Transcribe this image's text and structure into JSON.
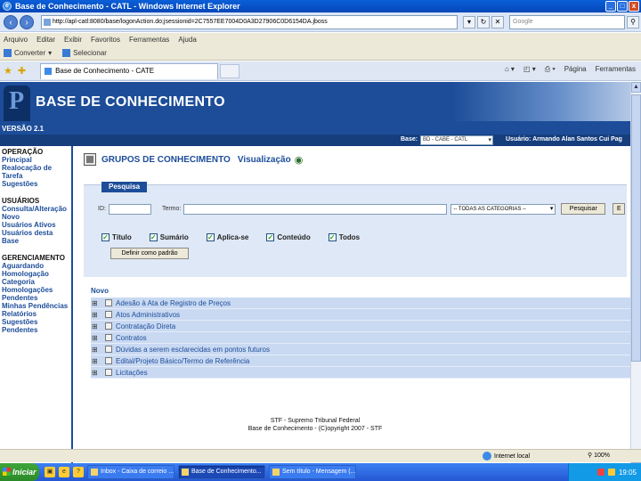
{
  "window": {
    "title": "Base de Conhecimento - CATL - Windows Internet Explorer",
    "min": "_",
    "max": "□",
    "close": "x"
  },
  "addressbar": {
    "url": "http://apl-catl:8080/base/logonAction.do;jsessionid=2C7557EE7004D0A3D27906C0D6154DA.jboss",
    "search_placeholder": "Google"
  },
  "menu": [
    "Arquivo",
    "Editar",
    "Exibir",
    "Favoritos",
    "Ferramentas",
    "Ajuda"
  ],
  "links": [
    "Converter",
    "Selecionar"
  ],
  "tab": {
    "label": "Base de Conhecimento - CATE",
    "tools": [
      "Página",
      "Ferramentas"
    ]
  },
  "header": {
    "title": "BASE DE CONHECIMENTO",
    "version": "VERSÃO 2.1",
    "base_label": "Base:",
    "base_value": "BD - CABE - CATL",
    "user": "Usuário: Armando Alan Santos Cui  Pag"
  },
  "sidebar": {
    "sections": [
      {
        "title": "OPERAÇÃO",
        "items": [
          "Principal",
          "Realocação de Tarefa",
          "Sugestões"
        ]
      },
      {
        "title": "USUÁRIOS",
        "items": [
          "Consulta/Alteração",
          "Novo",
          "Usuários Ativos",
          "Usuários desta Base"
        ]
      },
      {
        "title": "GERENCIAMENTO",
        "items": [
          "Aguardando Homologação",
          "Categoria",
          "Homologações Pendentes",
          "Minhas Pendências",
          "Relatórios",
          "Sugestões Pendentes"
        ]
      }
    ]
  },
  "main": {
    "title": "GRUPOS DE CONHECIMENTO",
    "subtitle": "Visualização",
    "search": {
      "legend": "Pesquisa",
      "id_label": "ID:",
      "term_label": "Termo:",
      "category": "-- TODAS AS CATEGORIAS --",
      "search_button": "Pesquisar",
      "extra_button": "E",
      "checkboxes": [
        "Título",
        "Sumário",
        "Aplica-se",
        "Conteúdo",
        "Todos"
      ],
      "reset_button": "Definir como padrão"
    },
    "tree": {
      "new_label": "Novo",
      "items": [
        "Adesão à Ata de Registro de Preços",
        "Atos Administrativos",
        "Contratação Direta",
        "Contratos",
        "Dúvidas a serem esclarecidas em pontos futuros",
        "Edital/Projeto Básico/Termo de Referência",
        "Licitações"
      ]
    }
  },
  "footer": {
    "line1": "STF - Supremo Tribunal Federal",
    "line2": "Base de Conhecimento - (C)opyright 2007 - STF"
  },
  "status": {
    "zone": "Internet local",
    "zoom": "100%"
  },
  "taskbar": {
    "start": "Iniciar",
    "tasks": [
      "Inbox - Caixa de correio ...",
      "Base de Conhecimento...",
      "Sem título - Mensagem (...)"
    ],
    "clock": "19:05"
  }
}
